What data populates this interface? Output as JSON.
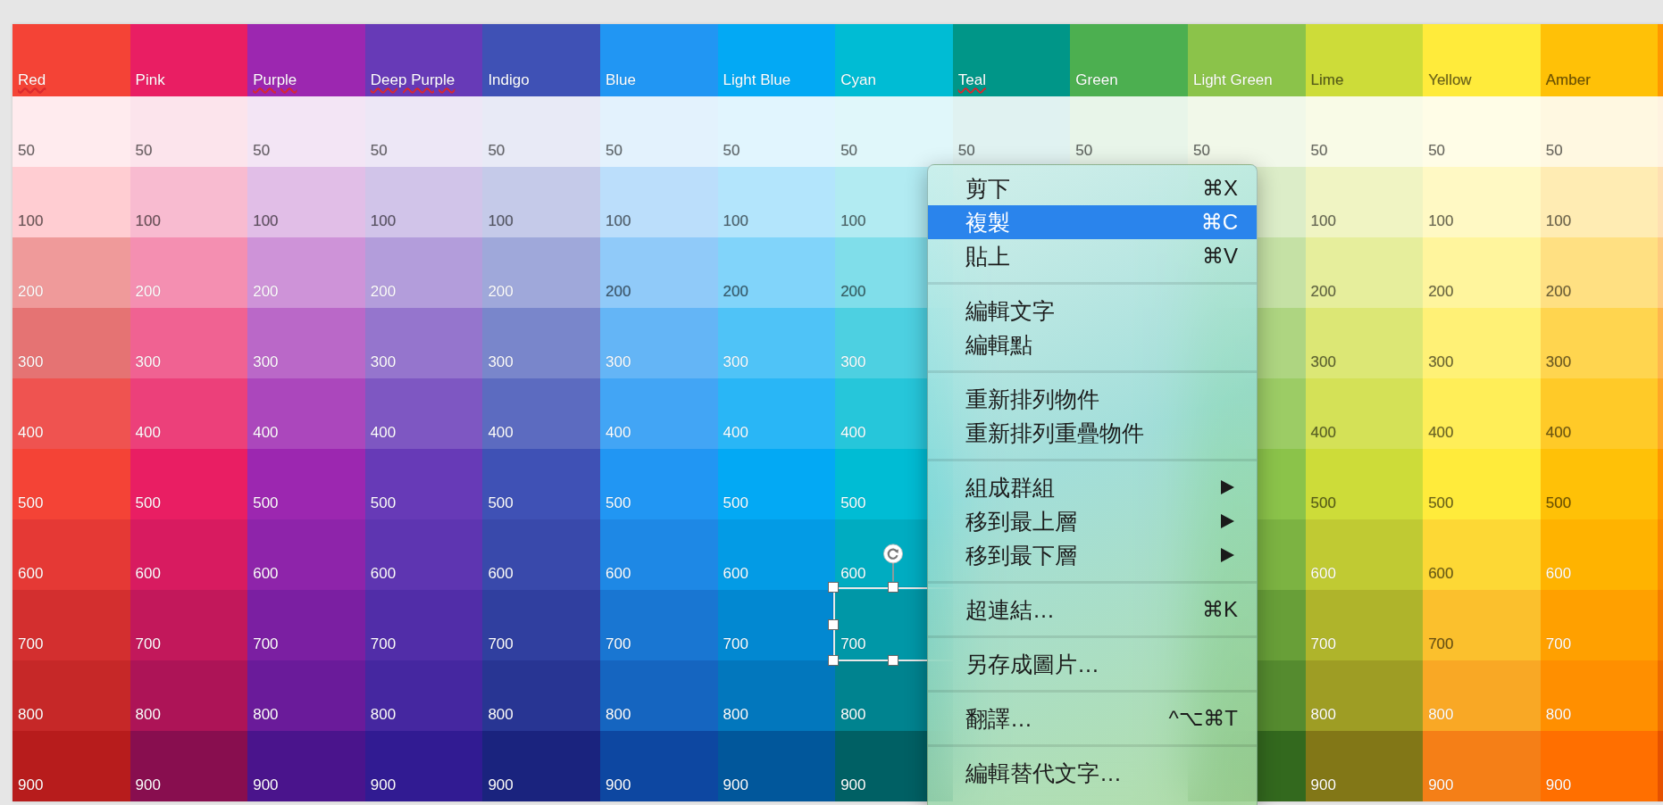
{
  "palette": {
    "columns": [
      {
        "name": "Red",
        "misspelled": true,
        "color": "#f44336",
        "shades": [
          {
            "label": "50",
            "color": "#ffebee",
            "selected": false
          },
          {
            "label": "100",
            "color": "#ffcdd2",
            "selected": false
          },
          {
            "label": "200",
            "color": "#ef9a9a",
            "selected": false
          },
          {
            "label": "300",
            "color": "#e57373",
            "selected": false
          },
          {
            "label": "400",
            "color": "#ef5350",
            "selected": false
          },
          {
            "label": "500",
            "color": "#f44336",
            "selected": false
          },
          {
            "label": "600",
            "color": "#e53935",
            "selected": false
          },
          {
            "label": "700",
            "color": "#d32f2f",
            "selected": false
          },
          {
            "label": "800",
            "color": "#c62828",
            "selected": false
          },
          {
            "label": "900",
            "color": "#b71c1c",
            "selected": false
          }
        ]
      },
      {
        "name": "Pink",
        "misspelled": false,
        "color": "#e91e63",
        "shades": [
          {
            "label": "50",
            "color": "#fce4ec",
            "selected": false
          },
          {
            "label": "100",
            "color": "#f8bbd0",
            "selected": false
          },
          {
            "label": "200",
            "color": "#f48fb1",
            "selected": false
          },
          {
            "label": "300",
            "color": "#f06292",
            "selected": false
          },
          {
            "label": "400",
            "color": "#ec407a",
            "selected": false
          },
          {
            "label": "500",
            "color": "#e91e63",
            "selected": false
          },
          {
            "label": "600",
            "color": "#d81b60",
            "selected": false
          },
          {
            "label": "700",
            "color": "#c2185b",
            "selected": false
          },
          {
            "label": "800",
            "color": "#ad1457",
            "selected": false
          },
          {
            "label": "900",
            "color": "#880e4f",
            "selected": false
          }
        ]
      },
      {
        "name": "Purple",
        "misspelled": true,
        "color": "#9c27b0",
        "shades": [
          {
            "label": "50",
            "color": "#f3e5f5",
            "selected": false
          },
          {
            "label": "100",
            "color": "#e1bee7",
            "selected": false
          },
          {
            "label": "200",
            "color": "#ce93d8",
            "selected": false
          },
          {
            "label": "300",
            "color": "#ba68c8",
            "selected": false
          },
          {
            "label": "400",
            "color": "#ab47bc",
            "selected": false
          },
          {
            "label": "500",
            "color": "#9c27b0",
            "selected": false
          },
          {
            "label": "600",
            "color": "#8e24aa",
            "selected": false
          },
          {
            "label": "700",
            "color": "#7b1fa2",
            "selected": false
          },
          {
            "label": "800",
            "color": "#6a1b9a",
            "selected": false
          },
          {
            "label": "900",
            "color": "#4a148c",
            "selected": false
          }
        ]
      },
      {
        "name": "Deep Purple",
        "misspelled": true,
        "color": "#673ab7",
        "shades": [
          {
            "label": "50",
            "color": "#ede7f6",
            "selected": false
          },
          {
            "label": "100",
            "color": "#d1c4e9",
            "selected": false
          },
          {
            "label": "200",
            "color": "#b39ddb",
            "selected": false
          },
          {
            "label": "300",
            "color": "#9575cd",
            "selected": false
          },
          {
            "label": "400",
            "color": "#7e57c2",
            "selected": false
          },
          {
            "label": "500",
            "color": "#673ab7",
            "selected": false
          },
          {
            "label": "600",
            "color": "#5e35b1",
            "selected": false
          },
          {
            "label": "700",
            "color": "#512da8",
            "selected": false
          },
          {
            "label": "800",
            "color": "#4527a0",
            "selected": false
          },
          {
            "label": "900",
            "color": "#311b92",
            "selected": false
          }
        ]
      },
      {
        "name": "Indigo",
        "misspelled": false,
        "color": "#3f51b5",
        "shades": [
          {
            "label": "50",
            "color": "#e8eaf6",
            "selected": false
          },
          {
            "label": "100",
            "color": "#c5cae9",
            "selected": false
          },
          {
            "label": "200",
            "color": "#9fa8da",
            "selected": false
          },
          {
            "label": "300",
            "color": "#7986cb",
            "selected": false
          },
          {
            "label": "400",
            "color": "#5c6bc0",
            "selected": false
          },
          {
            "label": "500",
            "color": "#3f51b5",
            "selected": false
          },
          {
            "label": "600",
            "color": "#3949ab",
            "selected": false
          },
          {
            "label": "700",
            "color": "#303f9f",
            "selected": false
          },
          {
            "label": "800",
            "color": "#283593",
            "selected": false
          },
          {
            "label": "900",
            "color": "#1a237e",
            "selected": false
          }
        ]
      },
      {
        "name": "Blue",
        "misspelled": false,
        "color": "#2196f3",
        "shades": [
          {
            "label": "50",
            "color": "#e3f2fd",
            "selected": false
          },
          {
            "label": "100",
            "color": "#bbdefb",
            "selected": false
          },
          {
            "label": "200",
            "color": "#90caf9",
            "selected": false
          },
          {
            "label": "300",
            "color": "#64b5f6",
            "selected": false
          },
          {
            "label": "400",
            "color": "#42a5f5",
            "selected": false
          },
          {
            "label": "500",
            "color": "#2196f3",
            "selected": false
          },
          {
            "label": "600",
            "color": "#1e88e5",
            "selected": false
          },
          {
            "label": "700",
            "color": "#1976d2",
            "selected": false
          },
          {
            "label": "800",
            "color": "#1565c0",
            "selected": false
          },
          {
            "label": "900",
            "color": "#0d47a1",
            "selected": false
          }
        ]
      },
      {
        "name": "Light Blue",
        "misspelled": false,
        "color": "#03a9f4",
        "shades": [
          {
            "label": "50",
            "color": "#e1f5fe",
            "selected": false
          },
          {
            "label": "100",
            "color": "#b3e5fc",
            "selected": false
          },
          {
            "label": "200",
            "color": "#81d4fa",
            "selected": false
          },
          {
            "label": "300",
            "color": "#4fc3f7",
            "selected": false
          },
          {
            "label": "400",
            "color": "#29b6f6",
            "selected": false
          },
          {
            "label": "500",
            "color": "#03a9f4",
            "selected": false
          },
          {
            "label": "600",
            "color": "#039be5",
            "selected": false
          },
          {
            "label": "700",
            "color": "#0288d1",
            "selected": false
          },
          {
            "label": "800",
            "color": "#0277bd",
            "selected": false
          },
          {
            "label": "900",
            "color": "#01579b",
            "selected": false
          }
        ]
      },
      {
        "name": "Cyan",
        "misspelled": false,
        "color": "#00bcd4",
        "shades": [
          {
            "label": "50",
            "color": "#e0f7fa",
            "selected": false
          },
          {
            "label": "100",
            "color": "#b2ebf2",
            "selected": false
          },
          {
            "label": "200",
            "color": "#80deea",
            "selected": false
          },
          {
            "label": "300",
            "color": "#4dd0e1",
            "selected": false
          },
          {
            "label": "400",
            "color": "#26c6da",
            "selected": false
          },
          {
            "label": "500",
            "color": "#00bcd4",
            "selected": false
          },
          {
            "label": "600",
            "color": "#00acc1",
            "selected": false
          },
          {
            "label": "700",
            "color": "#0097a7",
            "selected": true
          },
          {
            "label": "800",
            "color": "#00838f",
            "selected": false
          },
          {
            "label": "900",
            "color": "#006064",
            "selected": false
          }
        ]
      },
      {
        "name": "Teal",
        "misspelled": true,
        "color": "#009688",
        "shades": [
          {
            "label": "50",
            "color": "#e0f2f1",
            "selected": false
          }
        ]
      },
      {
        "name": "Green",
        "misspelled": false,
        "color": "#4caf50",
        "shades": [
          {
            "label": "50",
            "color": "#e8f5e9",
            "selected": false
          }
        ]
      },
      {
        "name": "Light Green",
        "misspelled": false,
        "color": "#8bc34a",
        "shades": [
          {
            "label": "50",
            "color": "#f1f8e9",
            "selected": false
          },
          {
            "color": "#dcedc8",
            "selected": false
          },
          {
            "color": "#c5e1a5",
            "selected": false
          },
          {
            "color": "#aed581",
            "selected": false
          },
          {
            "color": "#9ccc65",
            "selected": false
          },
          {
            "color": "#8bc34a",
            "selected": false
          },
          {
            "color": "#7cb342",
            "selected": false
          },
          {
            "color": "#689f38",
            "selected": false
          },
          {
            "color": "#558b2f",
            "selected": false
          },
          {
            "color": "#33691e",
            "selected": false
          }
        ]
      },
      {
        "name": "Lime",
        "misspelled": false,
        "color": "#cddc39",
        "shades": [
          {
            "label": "50",
            "color": "#f9fbe7",
            "selected": false
          },
          {
            "label": "100",
            "color": "#f0f4c3",
            "selected": false
          },
          {
            "label": "200",
            "color": "#e6ee9c",
            "selected": false
          },
          {
            "label": "300",
            "color": "#dce775",
            "selected": false
          },
          {
            "label": "400",
            "color": "#d4e157",
            "selected": false
          },
          {
            "label": "500",
            "color": "#cddc39",
            "selected": false
          },
          {
            "label": "600",
            "color": "#c0ca33",
            "selected": false
          },
          {
            "label": "700",
            "color": "#afb42b",
            "selected": false
          },
          {
            "label": "800",
            "color": "#9e9d24",
            "selected": false
          },
          {
            "label": "900",
            "color": "#827717",
            "selected": false
          }
        ]
      },
      {
        "name": "Yellow",
        "misspelled": false,
        "color": "#ffeb3b",
        "shades": [
          {
            "label": "50",
            "color": "#fffde7",
            "selected": false
          },
          {
            "label": "100",
            "color": "#fff9c4",
            "selected": false
          },
          {
            "label": "200",
            "color": "#fff59d",
            "selected": false
          },
          {
            "label": "300",
            "color": "#fff176",
            "selected": false
          },
          {
            "label": "400",
            "color": "#ffee58",
            "selected": false
          },
          {
            "label": "500",
            "color": "#ffeb3b",
            "selected": false
          },
          {
            "label": "600",
            "color": "#fdd835",
            "selected": false
          },
          {
            "label": "700",
            "color": "#fbc02d",
            "selected": false
          },
          {
            "label": "800",
            "color": "#f9a825",
            "selected": false
          },
          {
            "label": "900",
            "color": "#f57f17",
            "selected": false
          }
        ]
      },
      {
        "name": "Amber",
        "misspelled": false,
        "color": "#ffc107",
        "shades": [
          {
            "label": "50",
            "color": "#fff8e1",
            "selected": false
          },
          {
            "label": "100",
            "color": "#ffecb3",
            "selected": false
          },
          {
            "label": "200",
            "color": "#ffe082",
            "selected": false
          },
          {
            "label": "300",
            "color": "#ffd54f",
            "selected": false
          },
          {
            "label": "400",
            "color": "#ffca28",
            "selected": false
          },
          {
            "label": "500",
            "color": "#ffc107",
            "selected": false
          },
          {
            "label": "600",
            "color": "#ffb300",
            "selected": false
          },
          {
            "label": "700",
            "color": "#ffa000",
            "selected": false
          },
          {
            "label": "800",
            "color": "#ff8f00",
            "selected": false
          },
          {
            "label": "900",
            "color": "#ff6f00",
            "selected": false
          }
        ]
      },
      {
        "color": "#ff9800",
        "shades": [
          {
            "color": "#fff3e0",
            "selected": false
          },
          {
            "color": "#ffe0b2",
            "selected": false
          },
          {
            "color": "#ffcc80",
            "selected": false
          },
          {
            "color": "#ffb74d",
            "selected": false
          },
          {
            "color": "#ffa726",
            "selected": false
          },
          {
            "color": "#ff9800",
            "selected": false
          },
          {
            "color": "#fb8c00",
            "selected": false
          },
          {
            "color": "#f57c00",
            "selected": false
          },
          {
            "color": "#ef6c00",
            "selected": false
          },
          {
            "color": "#e65100",
            "selected": false
          }
        ]
      }
    ]
  },
  "context_menu": {
    "items": [
      {
        "kind": "item",
        "label": "剪下",
        "shortcut": "⌘X",
        "submenu": false,
        "selected": false
      },
      {
        "kind": "item",
        "label": "複製",
        "shortcut": "⌘C",
        "submenu": false,
        "selected": true
      },
      {
        "kind": "item",
        "label": "貼上",
        "shortcut": "⌘V",
        "submenu": false,
        "selected": false
      },
      {
        "kind": "separator"
      },
      {
        "kind": "item",
        "label": "編輯文字",
        "submenu": false,
        "selected": false
      },
      {
        "kind": "item",
        "label": "編輯點",
        "submenu": false,
        "selected": false
      },
      {
        "kind": "separator"
      },
      {
        "kind": "item",
        "label": "重新排列物件",
        "submenu": false,
        "selected": false
      },
      {
        "kind": "item",
        "label": "重新排列重疊物件",
        "submenu": false,
        "selected": false
      },
      {
        "kind": "separator"
      },
      {
        "kind": "item",
        "label": "組成群組",
        "submenu": true,
        "selected": false
      },
      {
        "kind": "item",
        "label": "移到最上層",
        "submenu": true,
        "selected": false
      },
      {
        "kind": "item",
        "label": "移到最下層",
        "submenu": true,
        "selected": false
      },
      {
        "kind": "separator"
      },
      {
        "kind": "item",
        "label": "超連結…",
        "shortcut": "⌘K",
        "submenu": false,
        "selected": false
      },
      {
        "kind": "separator"
      },
      {
        "kind": "item",
        "label": "另存成圖片…",
        "submenu": false,
        "selected": false
      },
      {
        "kind": "separator"
      },
      {
        "kind": "item",
        "label": "翻譯…",
        "shortcut": "^⌥⌘T",
        "submenu": false,
        "selected": false
      },
      {
        "kind": "separator"
      },
      {
        "kind": "item",
        "label": "編輯替代文字…",
        "submenu": false,
        "selected": false
      }
    ]
  }
}
